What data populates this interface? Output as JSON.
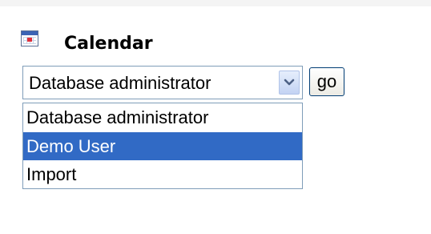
{
  "calendar": {
    "icon": "calendar-icon",
    "title": "Calendar"
  },
  "user_select": {
    "selected_value": "Database administrator",
    "arrow_icon": "chevron-down-icon",
    "options": [
      {
        "label": "Database administrator",
        "highlighted": false
      },
      {
        "label": "Demo User",
        "highlighted": true
      },
      {
        "label": "Import",
        "highlighted": false
      }
    ]
  },
  "go_button": {
    "label": "go"
  },
  "colors": {
    "highlight": "#316ac5",
    "border": "#7f9db9"
  }
}
